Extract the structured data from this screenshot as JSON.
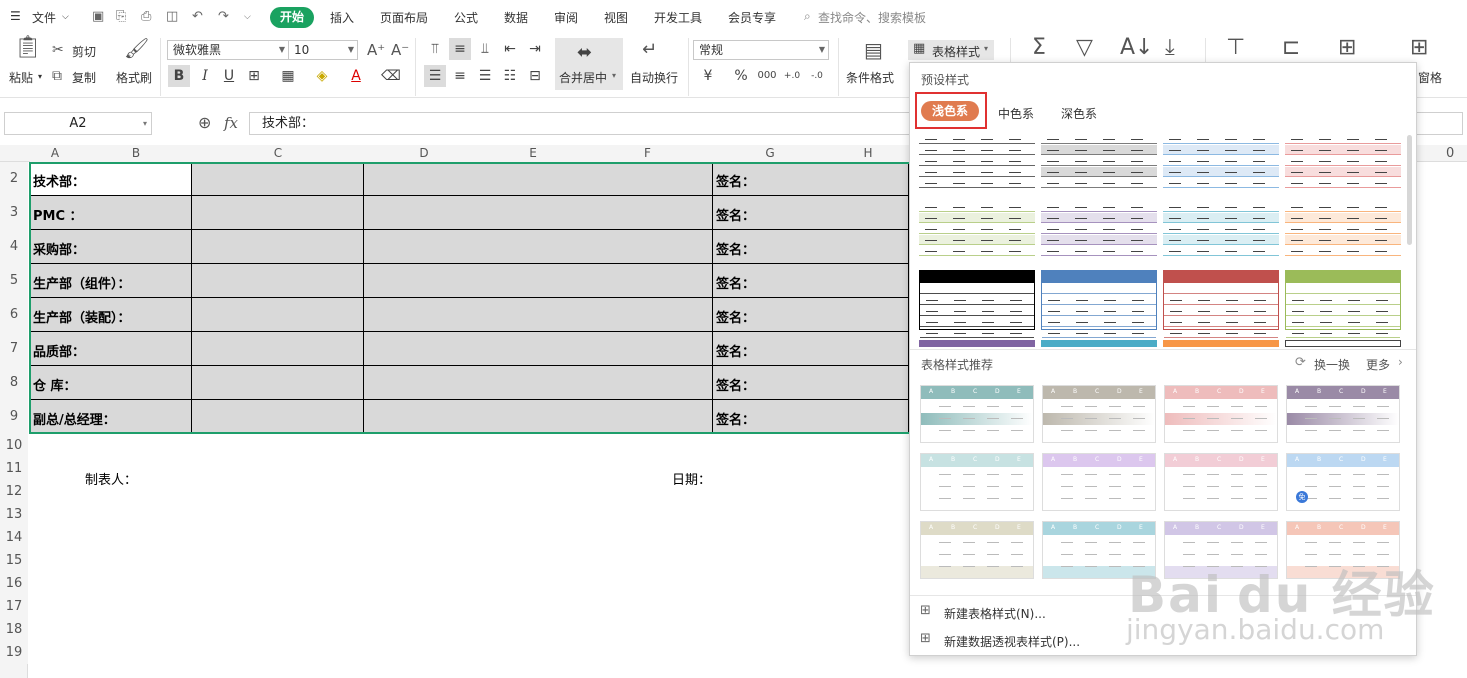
{
  "menubar": {
    "menu_label": "文件",
    "tabs": [
      "开始",
      "插入",
      "页面布局",
      "公式",
      "数据",
      "审阅",
      "视图",
      "开发工具",
      "会员专享"
    ],
    "search_placeholder": "查找命令、搜索模板"
  },
  "ribbon": {
    "paste": "粘贴",
    "cut": "剪切",
    "copy": "复制",
    "format_painter": "格式刷",
    "font_name": "微软雅黑",
    "font_size": "10",
    "merge_center": "合并居中",
    "wrap_text": "自动换行",
    "number_format": "常规",
    "conditional_format": "条件格式",
    "table_style": "表格样式",
    "freeze_panes": "窗格"
  },
  "formula_bar": {
    "cell_ref": "A2",
    "fx": "fx",
    "value": "技术部："
  },
  "grid": {
    "columns": [
      "A",
      "B",
      "C",
      "D",
      "E",
      "F",
      "G",
      "H"
    ],
    "row_numbers": [
      "2",
      "3",
      "4",
      "5",
      "6",
      "7",
      "8",
      "9",
      "10",
      "11",
      "12",
      "13",
      "14",
      "15",
      "16",
      "17",
      "18",
      "19"
    ],
    "dept_labels": [
      "技术部：",
      "PMC  ：",
      "采购部：",
      "生产部（组件）：",
      "生产部（装配）：",
      "品质部：",
      "仓  库：",
      "副总/总经理："
    ],
    "sign_label": "签名：",
    "maker_label": "制表人：",
    "date_label": "日期：",
    "right_value": "0"
  },
  "panel": {
    "preset_title": "预设样式",
    "tabs": [
      "浅色系",
      "中色系",
      "深色系"
    ],
    "recommend_title": "表格样式推荐",
    "refresh": "换一换",
    "more": "更多",
    "new_table_style": "新建表格样式(N)...",
    "new_pivot_style": "新建数据透视表样式(P)...",
    "free_badge": "免",
    "rec_header": [
      "A",
      "B",
      "C",
      "D",
      "E"
    ]
  },
  "colors": {
    "active_tab": "#1aa260",
    "pill_orange": "#e07b4f",
    "highlight_red": "#e03131",
    "selection_green": "#1e9e6b"
  },
  "watermark": {
    "brand": "Bai du 经验",
    "url": "jingyan.baidu.com"
  }
}
